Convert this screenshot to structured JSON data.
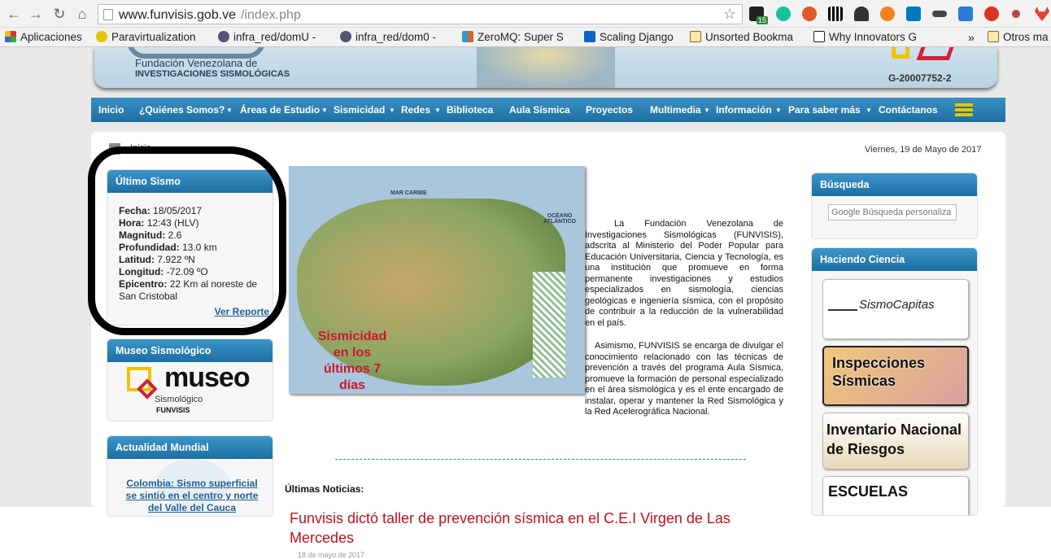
{
  "browser": {
    "url_host": "www.funvisis.gob.ve",
    "url_path": "/index.php",
    "badge_count": "15"
  },
  "bookmarks": [
    {
      "label": "Aplicaciones",
      "color": "#d33"
    },
    {
      "label": "Paravirtualization",
      "color": "#e8c200"
    },
    {
      "label": "infra_red/domU -",
      "color": "#557"
    },
    {
      "label": "infra_red/dom0 -",
      "color": "#557"
    },
    {
      "label": "ZeroMQ: Super S",
      "color": "#c63"
    },
    {
      "label": "Scaling Django",
      "color": "#0a66c2"
    },
    {
      "label": "Unsorted Bookma",
      "color": "#c9a227"
    },
    {
      "label": "Why Innovators G",
      "color": "#222"
    },
    {
      "label": "Otros ma",
      "color": "#c9a227"
    }
  ],
  "site": {
    "banner_small": "Fundación Venezolana de",
    "banner_big": "INVESTIGACIONES SISMOLÓGICAS",
    "rif": "G-20007752-2",
    "menu": [
      "Inicio",
      "¿Quiénes Somos?",
      "Áreas de Estudio",
      "Sismicidad",
      "Redes",
      "Biblioteca",
      "Aula Sísmica",
      "Proyectos",
      "Multimedia",
      "Información",
      "Para saber más",
      "Contáctanos"
    ],
    "breadcrumb": "Inicio",
    "date": "Viernes, 19 de Mayo de 2017"
  },
  "ultimo_sismo": {
    "title": "Último Sismo",
    "fecha_l": "Fecha:",
    "fecha": "18/05/2017",
    "hora_l": "Hora:",
    "hora": "12:43 (HLV)",
    "mag_l": "Magnitud:",
    "mag": "2.6",
    "prof_l": "Profundidad:",
    "prof": "13.0 km",
    "lat_l": "Latitud:",
    "lat": "7.922 ºN",
    "lon_l": "Longitud:",
    "lon": "-72.09 ºO",
    "epi_l": "Epicentro:",
    "epi": "22 Km al noreste de San Cristobal",
    "link": "Ver Reporte"
  },
  "museo": {
    "title": "Museo Sismológico",
    "logo_word": "museo",
    "logo_sub": "Sismológico",
    "logo_org": "FUNVISIS"
  },
  "actualidad": {
    "title": "Actualidad Mundial",
    "headline": "Colombia: Sismo superficial se sintió en el centro y norte del Valle del Cauca"
  },
  "map": {
    "caption": "Sismicidad en los últimos 7 días",
    "mar": "MAR CARIBE",
    "oceano": "OCÉANO ATLÁNTICO"
  },
  "intro": {
    "p1": "La Fundación Venezolana de Investigaciones Sismológicas (FUNVISIS), adscrita al Ministerio del Poder Popular para Educación Universitaria, Ciencia y Tecnología, es una institución que promueve en forma permanente investigaciones y estudios especializados en sismología, ciencias geológicas e ingeniería sísmica, con el propósito de contribuir a la reducción de la vulnerabilidad en el país.",
    "p2": "Asimismo, FUNVISIS se encarga de divulgar el conocimiento relacionado con las técnicas de prevención a través del programa Aula Sísmica, promueve la formación de personal especializado en el área sismológica y es el ente encargado de instalar, operar y mantener la Red Sismológica y la Red Acelerográfica Nacional."
  },
  "news": {
    "label": "Últimas Noticias:",
    "title": "Funvisis dictó taller de prevención sísmica en el C.E.I Virgen de Las Mercedes",
    "date": "18 de mayo de 2017"
  },
  "busqueda": {
    "title": "Búsqueda",
    "placeholder": "Google Búsqueda personaliza"
  },
  "ciencia": {
    "title": "Haciendo Ciencia",
    "items": [
      "SismoCapitas",
      "Inspecciones Sísmicas",
      "Inventario Nacional de Riesgos",
      "ESCUELAS"
    ]
  }
}
